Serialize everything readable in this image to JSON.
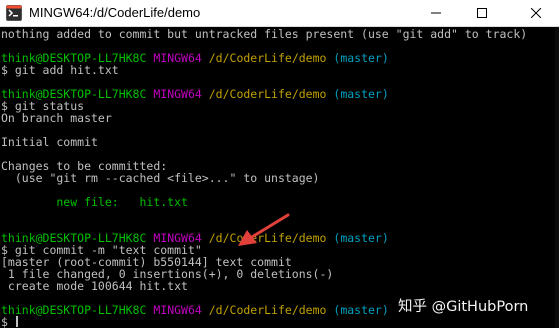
{
  "window": {
    "title": "MINGW64:/d/CoderLife/demo",
    "icon": "git-bash-icon",
    "controls": [
      "minimize-icon",
      "maximize-icon",
      "close-icon"
    ]
  },
  "colors": {
    "background": "#000000",
    "text": "#c0c0c0",
    "user": "#00c000",
    "env": "#c000c0",
    "path": "#c0a000",
    "branch": "#00a0c0",
    "staged": "#00c000",
    "arrow": "#e2413b"
  },
  "terminal": {
    "line0": "nothing added to commit but untracked files present (use \"git add\" to track)",
    "prompt1": {
      "user": "think@DESKTOP-LL7HK8C",
      "env": "MINGW64",
      "path": "/d/CoderLife/demo",
      "branch": "(master)"
    },
    "cmd1": "$ git add hit.txt",
    "prompt2": {
      "user": "think@DESKTOP-LL7HK8C",
      "env": "MINGW64",
      "path": "/d/CoderLife/demo",
      "branch": "(master)"
    },
    "cmd2": "$ git status",
    "out_branch": "On branch master",
    "out_initial": "Initial commit",
    "out_changes": "Changes to be committed:",
    "out_unstage": "  (use \"git rm --cached <file>...\" to unstage)",
    "out_newfile": "        new file:   hit.txt",
    "prompt3": {
      "user": "think@DESKTOP-LL7HK8C",
      "env": "MINGW64",
      "path": "/d/CoderLife/demo",
      "branch": "(master)"
    },
    "cmd3": "$ git commit -m \"text commit\"",
    "out_commit": "[master (root-commit) b550144] text commit",
    "out_stats": " 1 file changed, 0 insertions(+), 0 deletions(-)",
    "out_mode": " create mode 100644 hit.txt",
    "prompt4": {
      "user": "think@DESKTOP-LL7HK8C",
      "env": "MINGW64",
      "path": "/d/CoderLife/demo",
      "branch": "(master)"
    },
    "cmd4": "$ "
  },
  "watermark": {
    "text": "知乎 @GitHubPorn"
  }
}
